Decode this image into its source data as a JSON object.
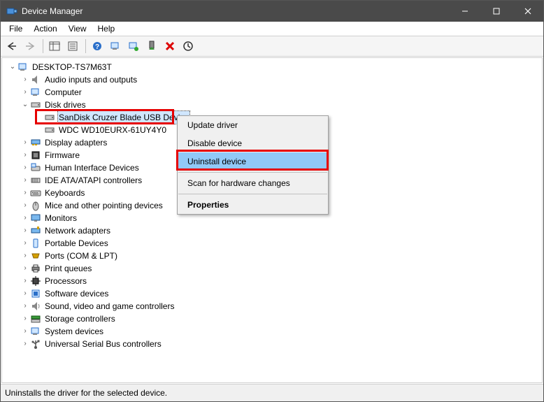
{
  "window": {
    "title": "Device Manager"
  },
  "menubar": {
    "file": "File",
    "action": "Action",
    "view": "View",
    "help": "Help"
  },
  "tree": {
    "root": "DESKTOP-TS7M63T",
    "items": [
      {
        "label": "Audio inputs and outputs"
      },
      {
        "label": "Computer"
      },
      {
        "label": "Disk drives",
        "expanded": true,
        "children": [
          {
            "label": "SanDisk Cruzer Blade USB Device",
            "selected": true
          },
          {
            "label": "WDC WD10EURX-61UY4Y0"
          }
        ]
      },
      {
        "label": "Display adapters"
      },
      {
        "label": "Firmware"
      },
      {
        "label": "Human Interface Devices"
      },
      {
        "label": "IDE ATA/ATAPI controllers"
      },
      {
        "label": "Keyboards"
      },
      {
        "label": "Mice and other pointing devices"
      },
      {
        "label": "Monitors"
      },
      {
        "label": "Network adapters"
      },
      {
        "label": "Portable Devices"
      },
      {
        "label": "Ports (COM & LPT)"
      },
      {
        "label": "Print queues"
      },
      {
        "label": "Processors"
      },
      {
        "label": "Software devices"
      },
      {
        "label": "Sound, video and game controllers"
      },
      {
        "label": "Storage controllers"
      },
      {
        "label": "System devices"
      },
      {
        "label": "Universal Serial Bus controllers"
      }
    ]
  },
  "context_menu": {
    "update_driver": "Update driver",
    "disable_device": "Disable device",
    "uninstall_device": "Uninstall device",
    "scan_hardware": "Scan for hardware changes",
    "properties": "Properties"
  },
  "statusbar": {
    "text": "Uninstalls the driver for the selected device."
  }
}
